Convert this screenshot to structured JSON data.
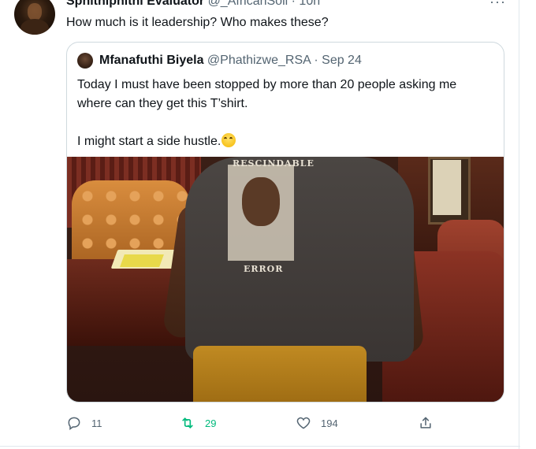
{
  "tweet": {
    "author_name": "Sphithiphithi Evaluator",
    "author_handle": "@_AfricanSoil",
    "dot": "·",
    "time": "10h",
    "text": "How much is it leadership? Who makes these?",
    "more": "···"
  },
  "quote": {
    "author_name": "Mfanafuthi Biyela",
    "author_handle": "@Phathizwe_RSA",
    "dot": "·",
    "date": "Sep 24",
    "text_line1": "Today I must have been stopped by more than 20 people asking me where can they get this T’shirt.",
    "text_line2": "I might start a side hustle.",
    "emoji": "face-with-tears-of-joy-emoji",
    "photo_top_text": "RESCINDABLE",
    "photo_bottom_text": "ERROR"
  },
  "actions": {
    "reply_count": "11",
    "retweet_count": "29",
    "like_count": "194",
    "retweet_color": "#00ba7c",
    "icon_color": "#536471"
  }
}
